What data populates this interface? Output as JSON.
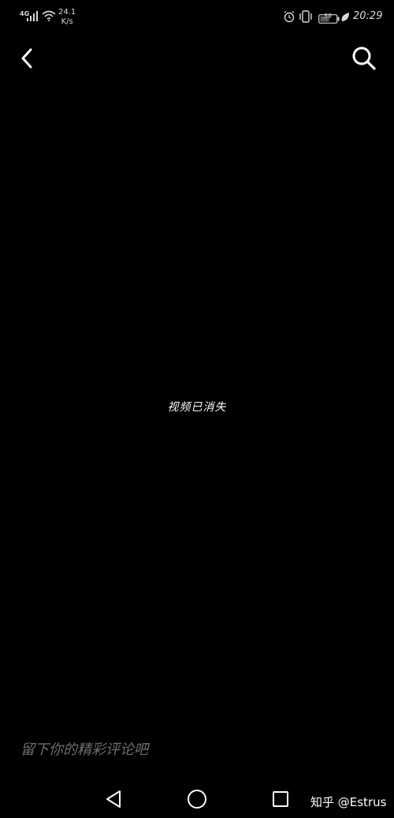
{
  "status_bar": {
    "network_type": "4G",
    "speed_value": "24.1",
    "speed_unit": "K/s",
    "battery_level": "59",
    "time": "20:29",
    "icons": [
      "signal-icon",
      "wifi-icon",
      "alarm-icon",
      "vibrate-icon",
      "battery-icon",
      "leaf-icon"
    ]
  },
  "nav": {
    "back_icon": "chevron-left-icon",
    "search_icon": "search-icon"
  },
  "main": {
    "message": "视频已消失"
  },
  "comment": {
    "placeholder": "留下你的精彩评论吧"
  },
  "system_nav": {
    "icons": [
      "triangle-back-icon",
      "circle-home-icon",
      "square-recent-icon"
    ]
  },
  "watermark": {
    "text": "知乎 @Estrus"
  }
}
